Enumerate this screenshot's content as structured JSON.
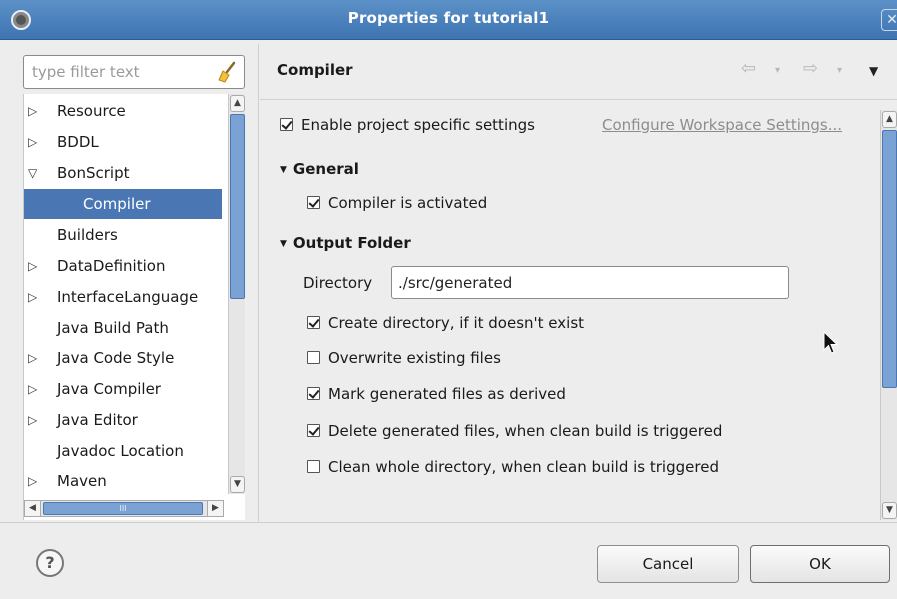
{
  "window": {
    "title": "Properties for tutorial1",
    "close_glyph": "✕"
  },
  "sidebar": {
    "filter_placeholder": "type filter text",
    "items": [
      {
        "label": "Resource",
        "arrow": "▷"
      },
      {
        "label": "BDDL",
        "arrow": "▷"
      },
      {
        "label": "BonScript",
        "arrow": "▽"
      },
      {
        "label": "Compiler",
        "arrow": "",
        "selected": true,
        "indent": 2
      },
      {
        "label": "Builders",
        "arrow": ""
      },
      {
        "label": "DataDefinition",
        "arrow": "▷"
      },
      {
        "label": "InterfaceLanguage",
        "arrow": "▷"
      },
      {
        "label": "Java Build Path",
        "arrow": ""
      },
      {
        "label": "Java Code Style",
        "arrow": "▷"
      },
      {
        "label": "Java Compiler",
        "arrow": "▷"
      },
      {
        "label": "Java Editor",
        "arrow": "▷"
      },
      {
        "label": "Javadoc Location",
        "arrow": ""
      },
      {
        "label": "Maven",
        "arrow": "▷"
      }
    ],
    "hscroll_grip": "III"
  },
  "page": {
    "title": "Compiler",
    "enable_label": "Enable project specific settings",
    "configure_link": "Configure Workspace Settings...",
    "general_header": "General",
    "compiler_activated_label": "Compiler is activated",
    "output_header": "Output Folder",
    "directory_label": "Directory",
    "directory_value": "./src/generated",
    "options": [
      {
        "label": "Create directory, if it doesn't exist",
        "checked": true
      },
      {
        "label": "Overwrite existing files",
        "checked": false
      },
      {
        "label": "Mark generated files as derived",
        "checked": true
      },
      {
        "label": "Delete generated files, when clean build is triggered",
        "checked": true
      },
      {
        "label": "Clean whole directory, when clean build is triggered",
        "checked": false
      }
    ]
  },
  "footer": {
    "help_glyph": "?",
    "cancel_label": "Cancel",
    "ok_label": "OK"
  },
  "colors": {
    "titlebar": "#4a80bd",
    "selection": "#4a77b4",
    "scroll_thumb": "#7aa2d4",
    "link": "#8d8d8d"
  }
}
